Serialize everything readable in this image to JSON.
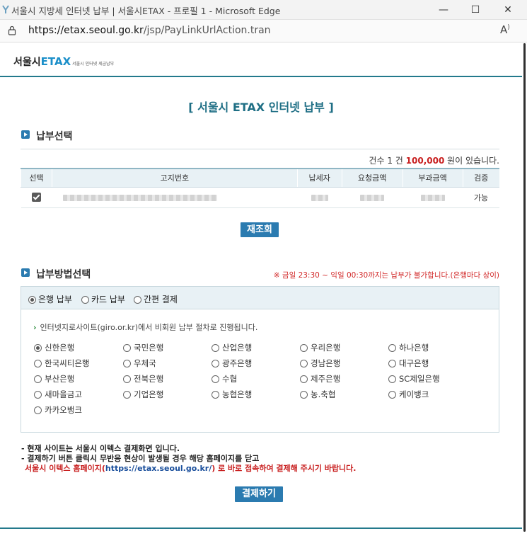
{
  "window": {
    "title": "서울시 지방세 인터넷 납부 | 서울시ETAX - 프로필 1 - Microsoft Edge",
    "minimize": "—",
    "maximize": "☐",
    "close": "✕"
  },
  "address": {
    "url_domain": "https://etax.seoul.go.kr",
    "url_path": "/jsp/PayLinkUrlAction.tran",
    "read_aloud": "A͔"
  },
  "header": {
    "logo_kr": "서울시",
    "logo_etax": "ETAX",
    "logo_sub": "서울시 인터넷 세금납부"
  },
  "page_title": "[ 서울시 ETAX 인터넷 납부 ]",
  "select_section": {
    "title": "납부선택",
    "count_prefix": "건수 1 건",
    "count_amount": "100,000",
    "count_suffix": "원이 있습니다.",
    "columns": [
      "선택",
      "고지번호",
      "납세자",
      "요청금액",
      "부과금액",
      "검증"
    ],
    "rows": [
      {
        "checked": true,
        "status": "가능"
      }
    ],
    "requery_button": "재조회"
  },
  "method_section": {
    "title": "납부방법선택",
    "notice": "※ 금일 23:30 ~ 익일 00:30까지는 납부가 불가합니다.(은행마다 상이)",
    "options": [
      "은행 납부",
      "카드 납부",
      "간편 결제"
    ],
    "selected_option": "은행 납부",
    "guide": "인터넷지로사이트(giro.or.kr)에서 비회원 납부 절차로 진행됩니다.",
    "banks": [
      "신한은행",
      "국민은행",
      "산업은행",
      "우리은행",
      "하나은행",
      "한국씨티은행",
      "우체국",
      "광주은행",
      "경남은행",
      "대구은행",
      "부산은행",
      "전북은행",
      "수협",
      "제주은행",
      "SC제일은행",
      "새마을금고",
      "기업은행",
      "농협은행",
      "농.축협",
      "케이뱅크",
      "카카오뱅크"
    ],
    "selected_bank": "신한은행"
  },
  "footnotes": {
    "line1": "- 현재 사이트는 서울시 이텍스 결제화면 입니다.",
    "line2": "- 결제하기 버튼 클릭시 무반응 현상이 발생될 경우 해당 홈페이지를 닫고",
    "line3_a": "서울시 이텍스 홈페이지(",
    "line3_link": "https://etax.seoul.go.kr/",
    "line3_b": ") 로 바로 접속하여 결제해 주시기 바랍니다."
  },
  "pay_button": "결제하기",
  "colors": {
    "accent": "#2b7bb0",
    "title_teal": "#1f6f85",
    "warning_red": "#c81f1f"
  }
}
